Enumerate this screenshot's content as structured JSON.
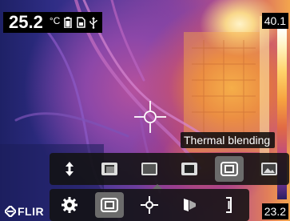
{
  "status_bar": {
    "temperature_value": "25.2",
    "temperature_unit": "°C",
    "icons": [
      "battery-icon",
      "sd-card-icon",
      "usb-icon"
    ]
  },
  "scale": {
    "max": "40.1",
    "min": "23.2"
  },
  "tooltip": {
    "text": "Thermal blending"
  },
  "fusion_submenu": {
    "items": [
      {
        "name": "sort-arrows-icon",
        "selected": false
      },
      {
        "name": "picture-in-picture-icon",
        "selected": false
      },
      {
        "name": "thermal-full-icon",
        "selected": false
      },
      {
        "name": "thermal-box-icon",
        "selected": false
      },
      {
        "name": "thermal-blending-icon",
        "selected": true
      },
      {
        "name": "digital-camera-icon",
        "selected": false
      }
    ]
  },
  "main_menu": {
    "items": [
      {
        "name": "settings-gear-icon",
        "selected": false
      },
      {
        "name": "image-mode-icon",
        "selected": true
      },
      {
        "name": "measurement-spot-icon",
        "selected": false
      },
      {
        "name": "color-palette-icon",
        "selected": false
      },
      {
        "name": "temperature-scale-icon",
        "selected": false
      }
    ]
  },
  "logo": {
    "text": "FLIR"
  },
  "colors": {
    "selected_bg": "#6b6b6b",
    "menu_bg": "#121212",
    "crosshair": "#ffffff"
  }
}
